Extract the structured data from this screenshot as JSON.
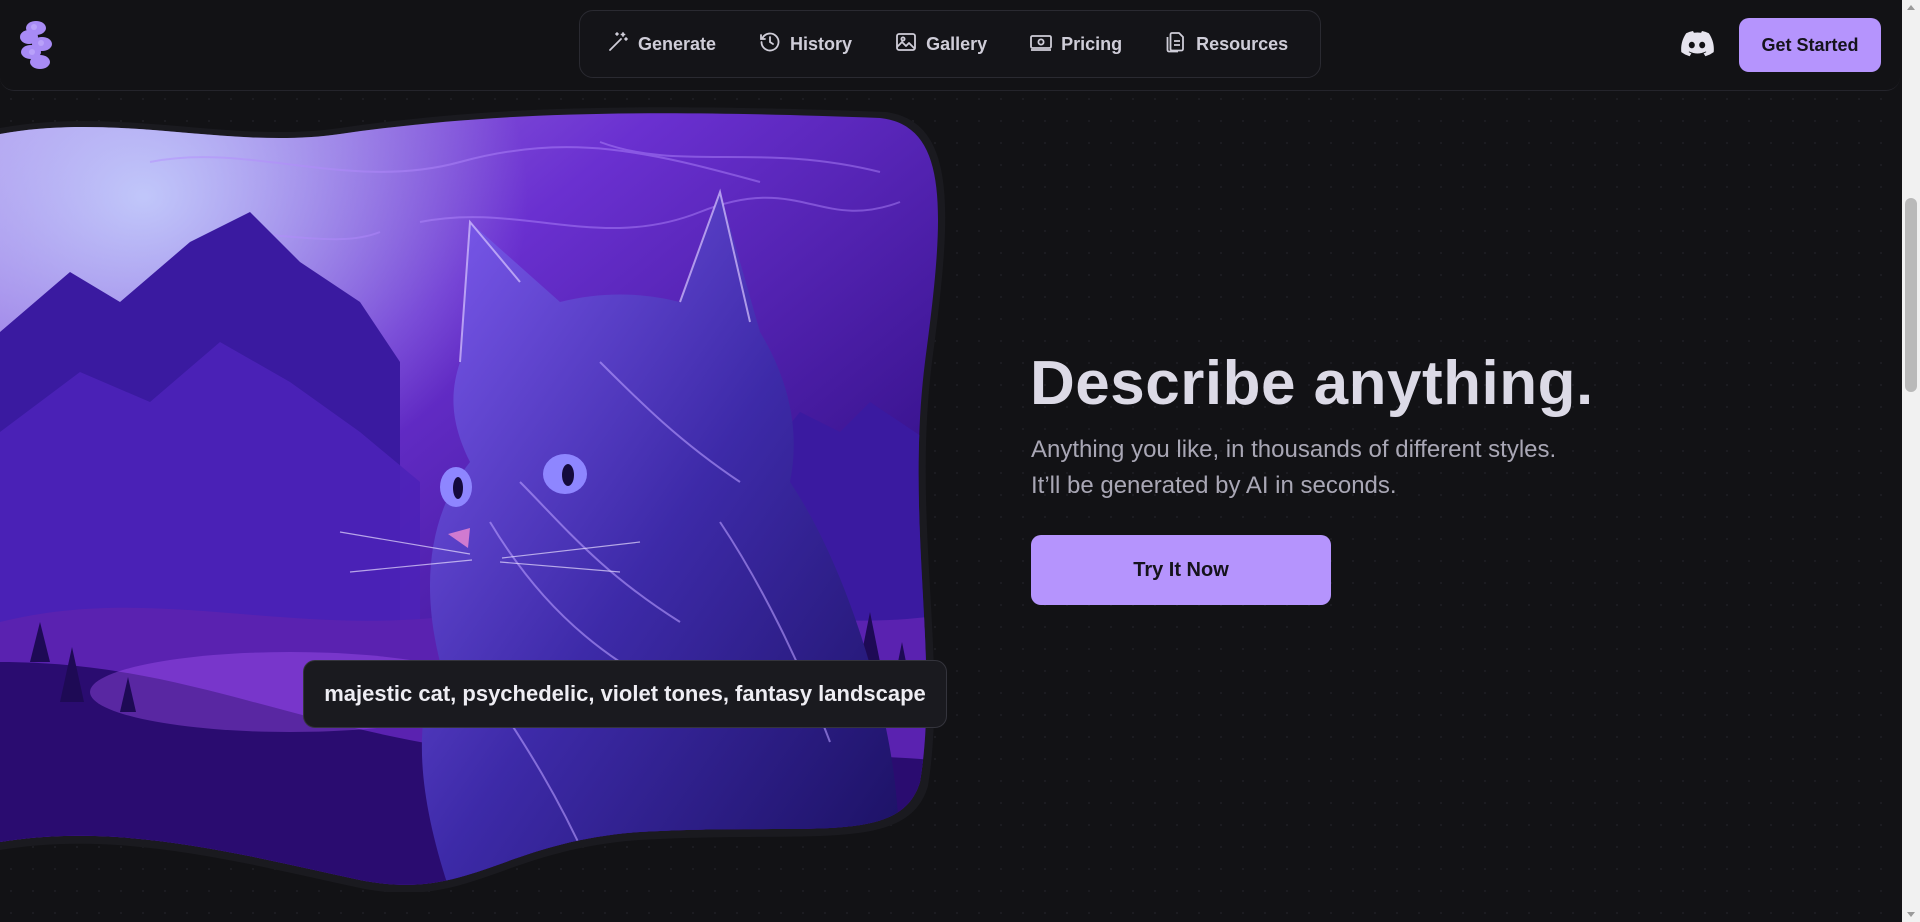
{
  "header": {
    "logo_icon": "purple-flower-logo-icon",
    "nav": [
      {
        "label": "Generate",
        "icon": "magic-wand-icon"
      },
      {
        "label": "History",
        "icon": "clock-history-icon"
      },
      {
        "label": "Gallery",
        "icon": "image-icon"
      },
      {
        "label": "Pricing",
        "icon": "banknote-icon"
      },
      {
        "label": "Resources",
        "icon": "documents-icon"
      }
    ],
    "discord_icon": "discord-icon",
    "cta_label": "Get Started"
  },
  "hero": {
    "image_subject": "purple-cat-fantasy-landscape-image",
    "prompt_text": "majestic cat, psychedelic, violet tones, fantasy landscape",
    "headline": "Describe anything.",
    "subcopy": "Anything you like, in thousands of different styles. It’ll be generated by AI in seconds.",
    "cta_label": "Try It Now"
  },
  "colors": {
    "background": "#121215",
    "accent": "#b594fd",
    "accent_text": "#15131c"
  }
}
